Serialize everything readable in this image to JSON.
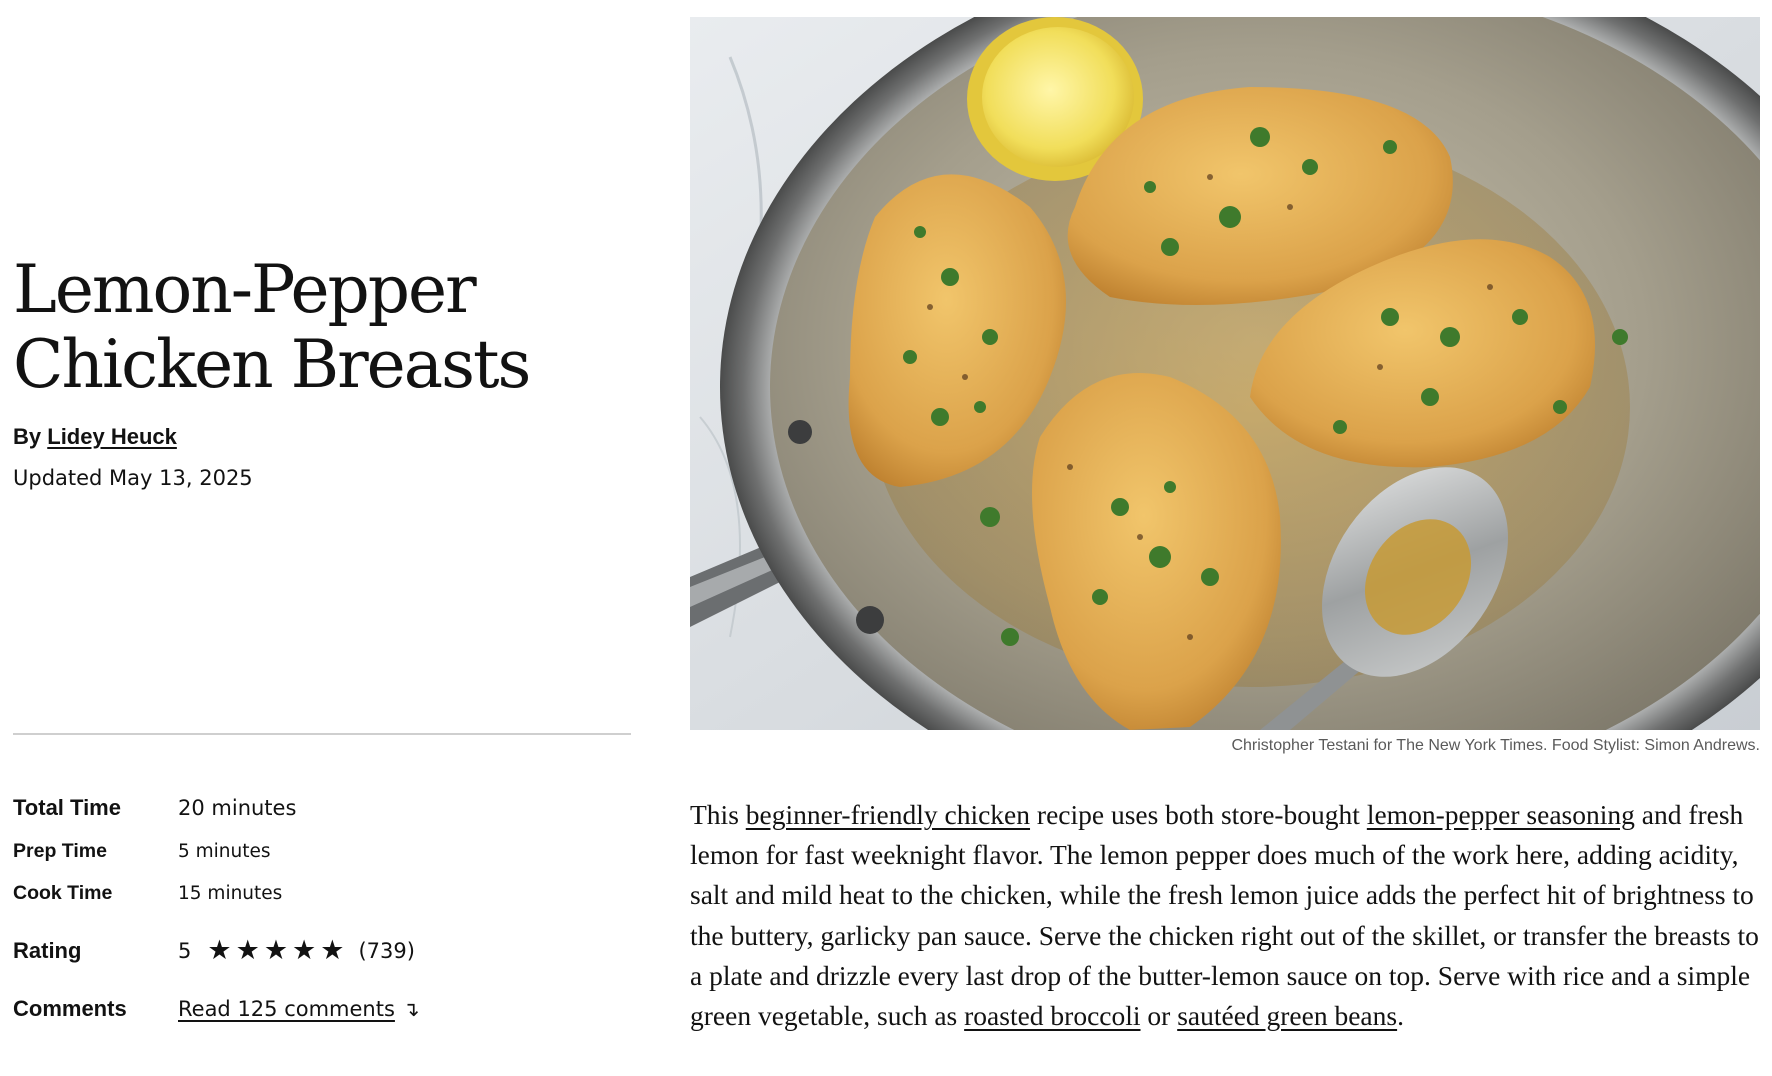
{
  "recipe": {
    "title_line1": "Lemon-Pepper",
    "title_line2": "Chicken Breasts",
    "byline_prefix": "By",
    "author": "Lidey Heuck",
    "updated": "Updated May 13, 2025"
  },
  "meta": {
    "total_time": {
      "label": "Total Time",
      "value": "20 minutes"
    },
    "prep_time": {
      "label": "Prep Time",
      "value": "5 minutes"
    },
    "cook_time": {
      "label": "Cook Time",
      "value": "15 minutes"
    },
    "rating": {
      "label": "Rating",
      "value": "5",
      "stars": 5,
      "count": "(739)"
    },
    "comments": {
      "label": "Comments",
      "link_text": "Read 125 comments",
      "arrow": "↴"
    }
  },
  "photo": {
    "credit": "Christopher Testani for The New York Times. Food Stylist: Simon Andrews."
  },
  "description": {
    "p1": "This ",
    "link1": "beginner-friendly chicken",
    "p2": " recipe uses both store-bought ",
    "link2": "lemon-pepper seasoning",
    "p3": " and fresh lemon for fast weeknight flavor. The lemon pepper does much of the work here, adding acidity, salt and mild heat to the chicken, while the fresh lemon juice adds the perfect hit of brightness to the buttery, garlicky pan sauce. Serve the chicken right out of the skillet, or transfer the breasts to a plate and drizzle every last drop of the butter-lemon sauce on top. Serve with rice and a simple green vegetable, such as ",
    "link3": "roasted broccoli",
    "p4": " or ",
    "link4": "sautéed green beans",
    "p5": "."
  },
  "colors": {
    "text": "#121212",
    "divider": "#cfcfcf",
    "credit": "#5a5a5a"
  }
}
